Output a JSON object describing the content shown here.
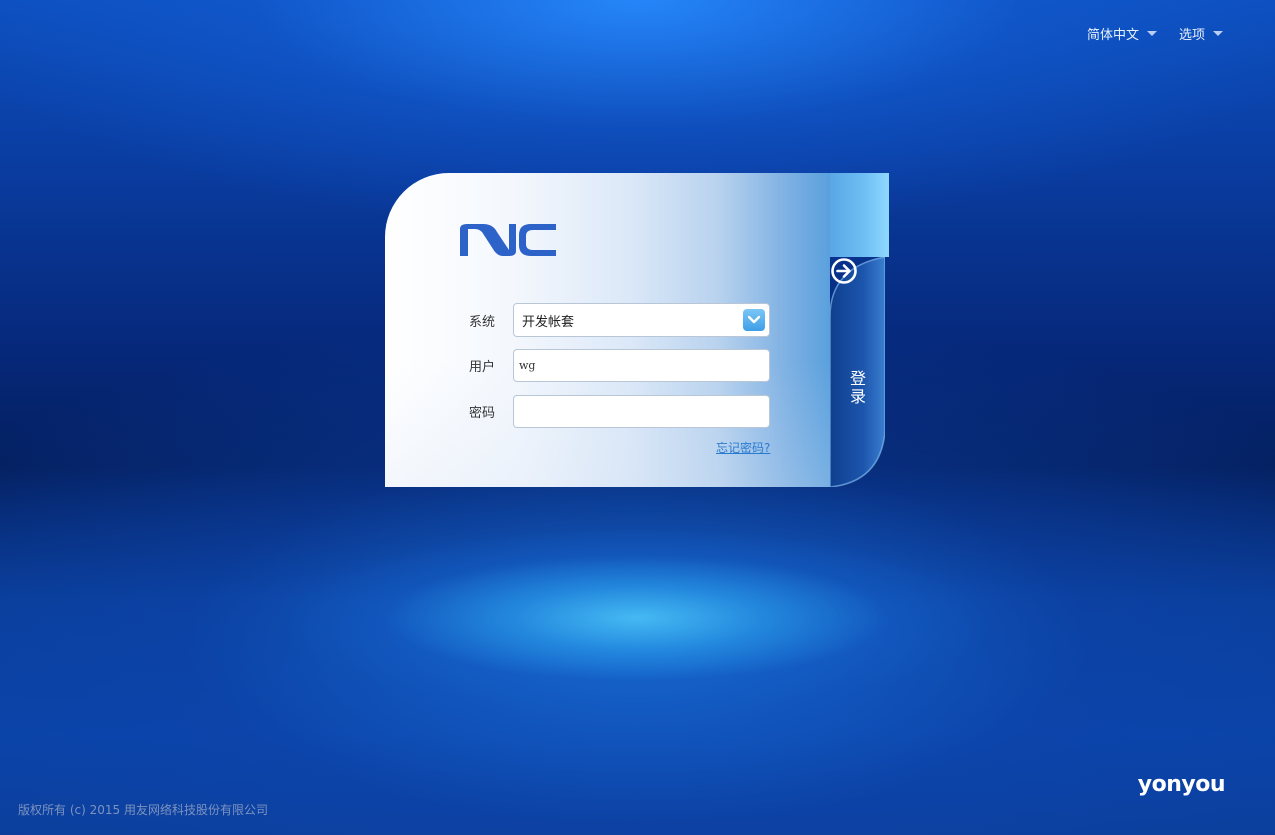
{
  "header": {
    "language": "简体中文",
    "options": "选项"
  },
  "logo": {
    "text": "NC",
    "color": "#2d63c8"
  },
  "form": {
    "system_label": "系统",
    "system_value": "开发帐套",
    "user_label": "用户",
    "user_value": "wg",
    "password_label": "密码",
    "password_value": "",
    "forgot_password": "忘记密码?"
  },
  "login_button": {
    "label": "登录",
    "icon": "arrow-right-circle-icon"
  },
  "footer": {
    "copyright": "版权所有 (c) 2015 用友网络科技股份有限公司",
    "brand": "yonyou"
  },
  "colors": {
    "accent": "#3e9ee6",
    "link": "#2a7bd0",
    "login_button": "#174b9e"
  }
}
